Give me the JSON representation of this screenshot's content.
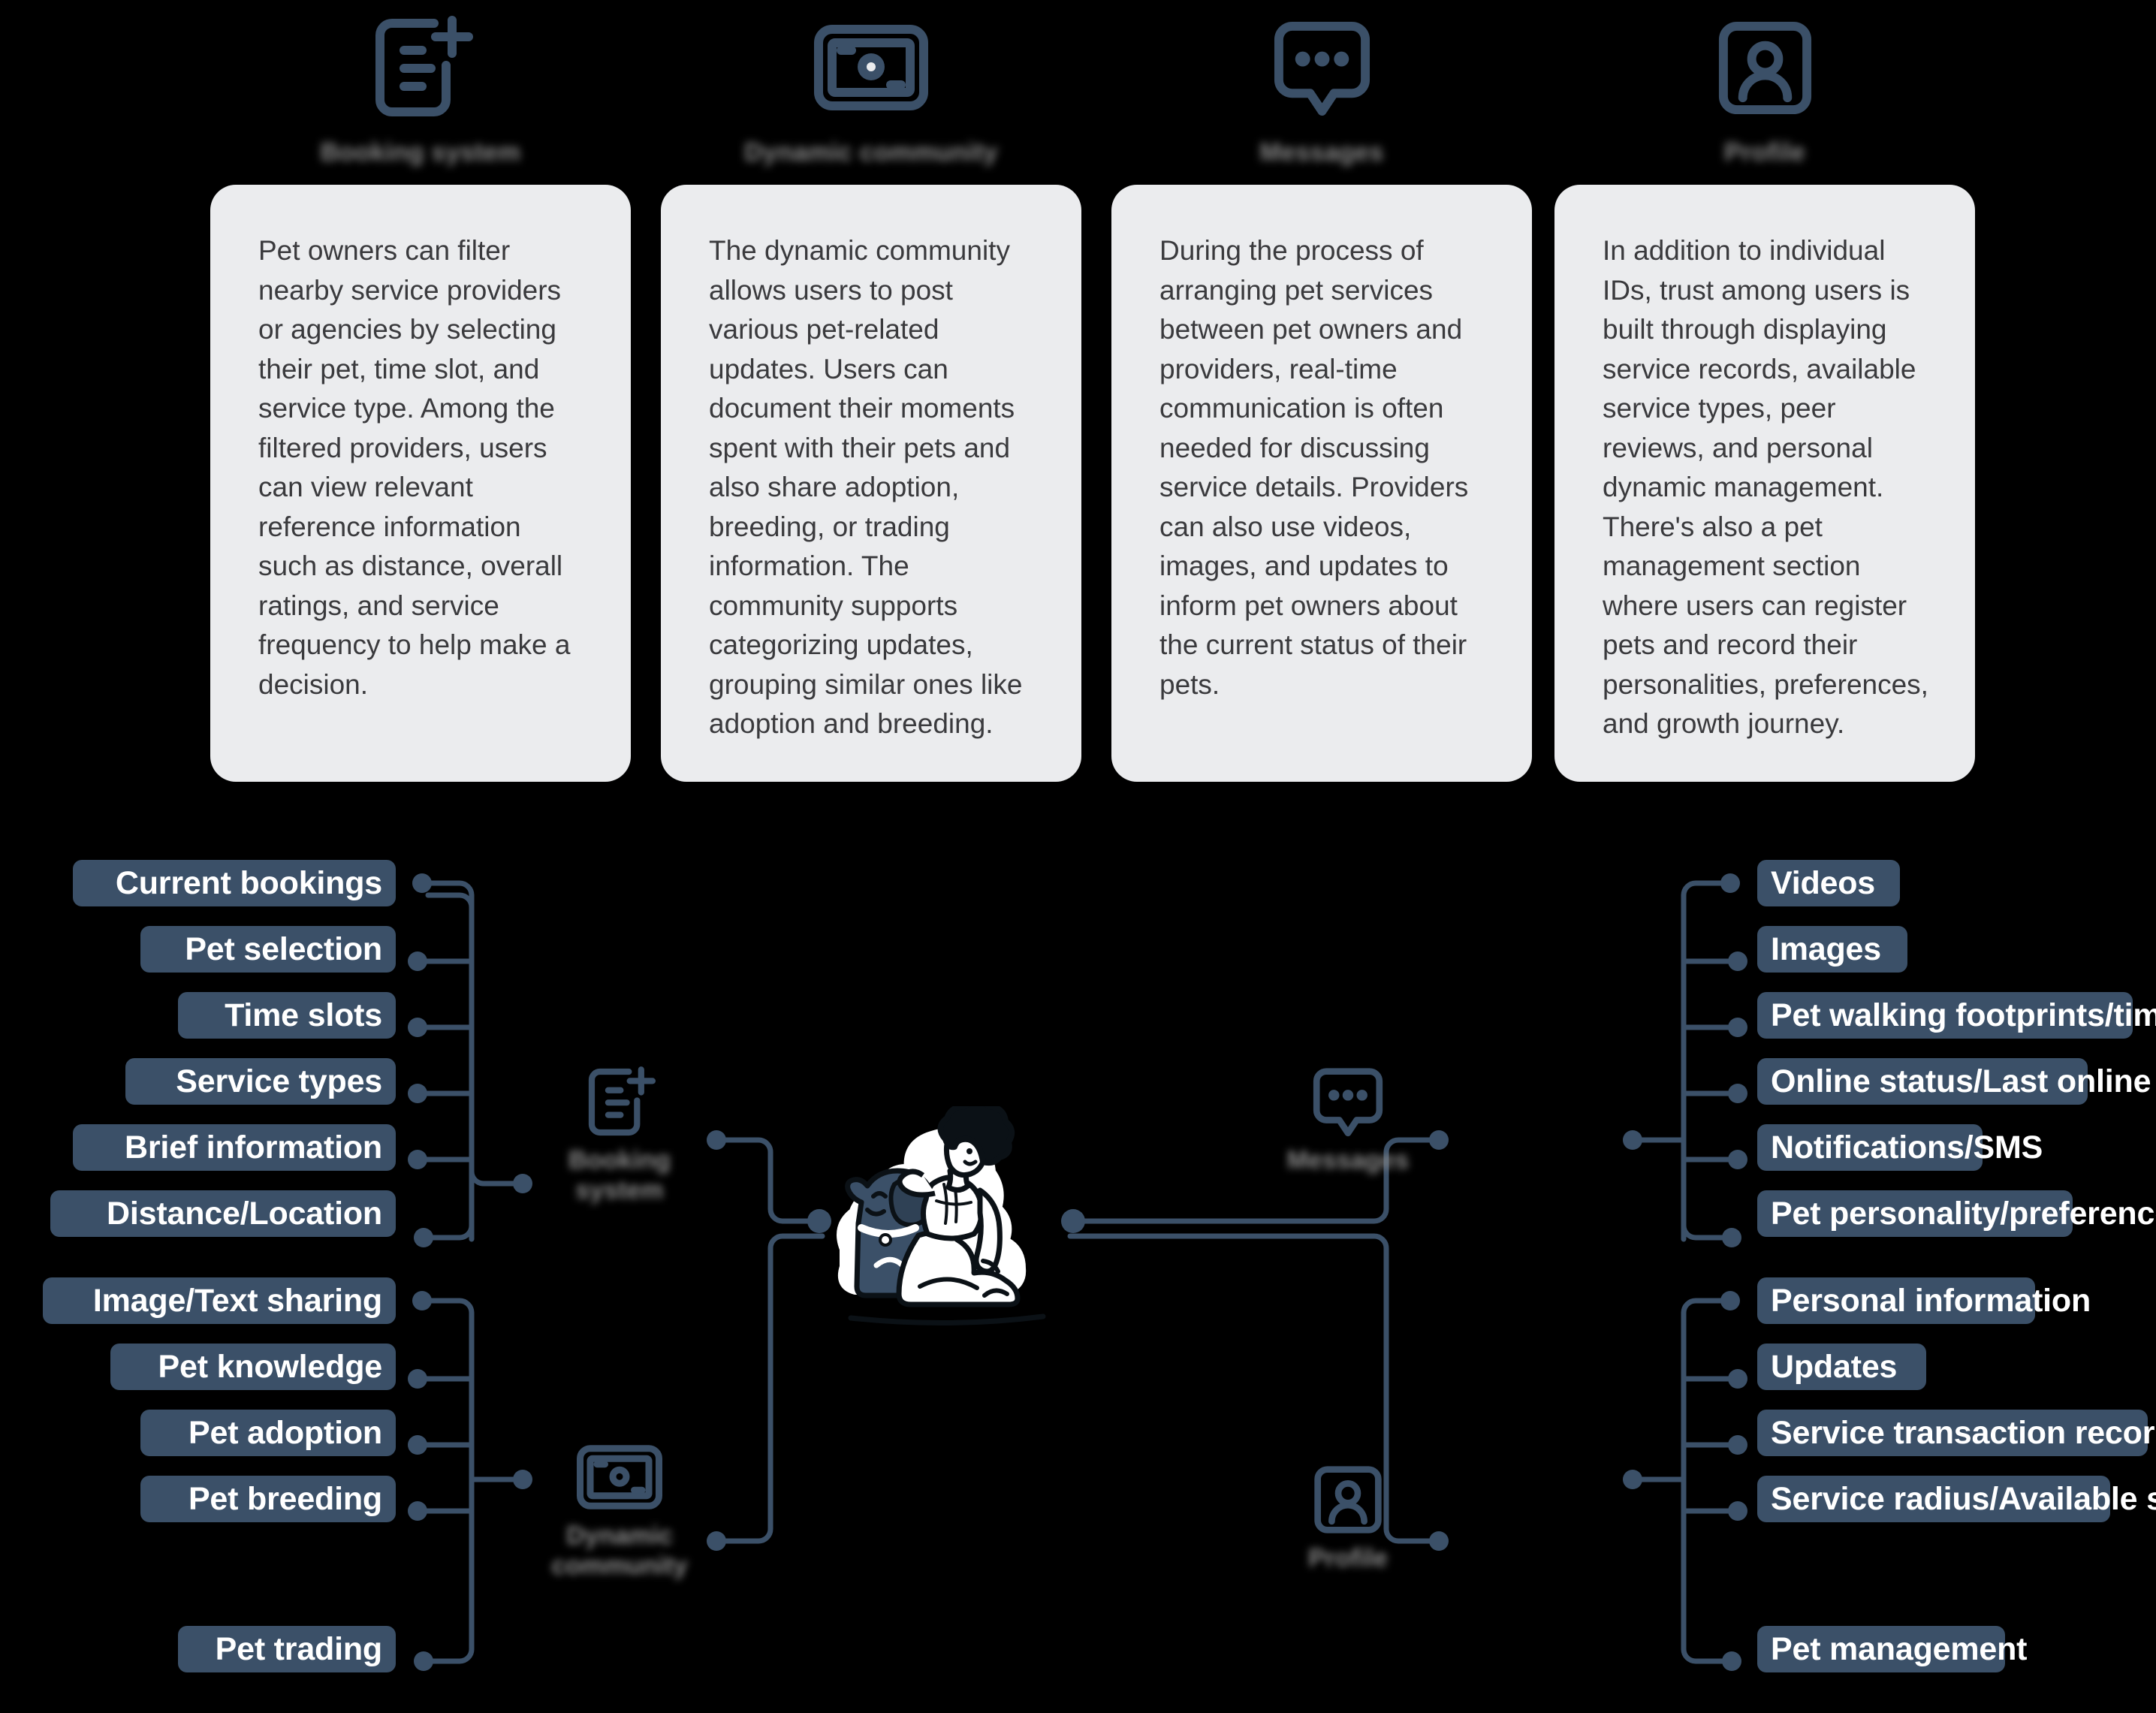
{
  "meta": {
    "accent_pill": "#3b5068",
    "accent_line": "#3b5068",
    "card_bg": "#ebecee",
    "card_text": "#3a3a3d",
    "page_bg": "#000000",
    "blurred_label_color": "#8a8a8a"
  },
  "top_section": {
    "columns": [
      {
        "icon": "document-add-icon",
        "title": "Booking system",
        "body": "Pet owners can filter nearby service providers or agencies by selecting their pet, time slot, and service type. Among the filtered providers, users can view relevant reference information such as distance, overall ratings, and service frequency to help make a decision."
      },
      {
        "icon": "media-card-icon",
        "title": "Dynamic community",
        "body": "The dynamic community allows users to post various pet-related updates. Users can document their moments spent with their pets and also share adoption, breeding, or trading information. The community supports categorizing updates, grouping similar ones like adoption and breeding."
      },
      {
        "icon": "chat-bubble-icon",
        "title": "Messages",
        "body": "During the process of arranging pet services between pet owners and providers, real-time communication is often needed for discussing service details. Providers can also use videos, images, and updates to inform pet owners about the current status of their pets."
      },
      {
        "icon": "profile-avatar-icon",
        "title": "Profile",
        "body": "In addition to individual IDs, trust among users is built through displaying service records, available service types, peer reviews, and personal dynamic management. There's also a pet management section where users can register pets and record their personalities, preferences, and growth journey."
      }
    ]
  },
  "mindmap": {
    "center": {
      "illustration": "person-with-dog-illustration"
    },
    "branches": [
      {
        "node_label": "Booking system",
        "node_icon": "document-add-icon",
        "side": "left",
        "items": [
          "Current bookings",
          "Pet selection",
          "Time slots",
          "Service types",
          "Brief information",
          "Distance/Location"
        ]
      },
      {
        "node_label": "Dynamic community",
        "node_icon": "media-card-icon",
        "side": "left",
        "items": [
          "Image/Text sharing",
          "Pet knowledge",
          "Pet adoption",
          "Pet breeding",
          "Pet trading"
        ]
      },
      {
        "node_label": "Messages",
        "node_icon": "chat-bubble-icon",
        "side": "right",
        "items": [
          "Videos",
          "Images",
          "Pet walking footprints/timestamps",
          "Online status/Last online time",
          "Notifications/SMS",
          "Pet personality/preferences"
        ]
      },
      {
        "node_label": "Profile",
        "node_icon": "profile-avatar-icon",
        "side": "right",
        "items": [
          "Personal information",
          "Updates",
          "Service transaction records/reviews",
          "Service radius/Available service",
          "Pet management"
        ]
      }
    ]
  }
}
